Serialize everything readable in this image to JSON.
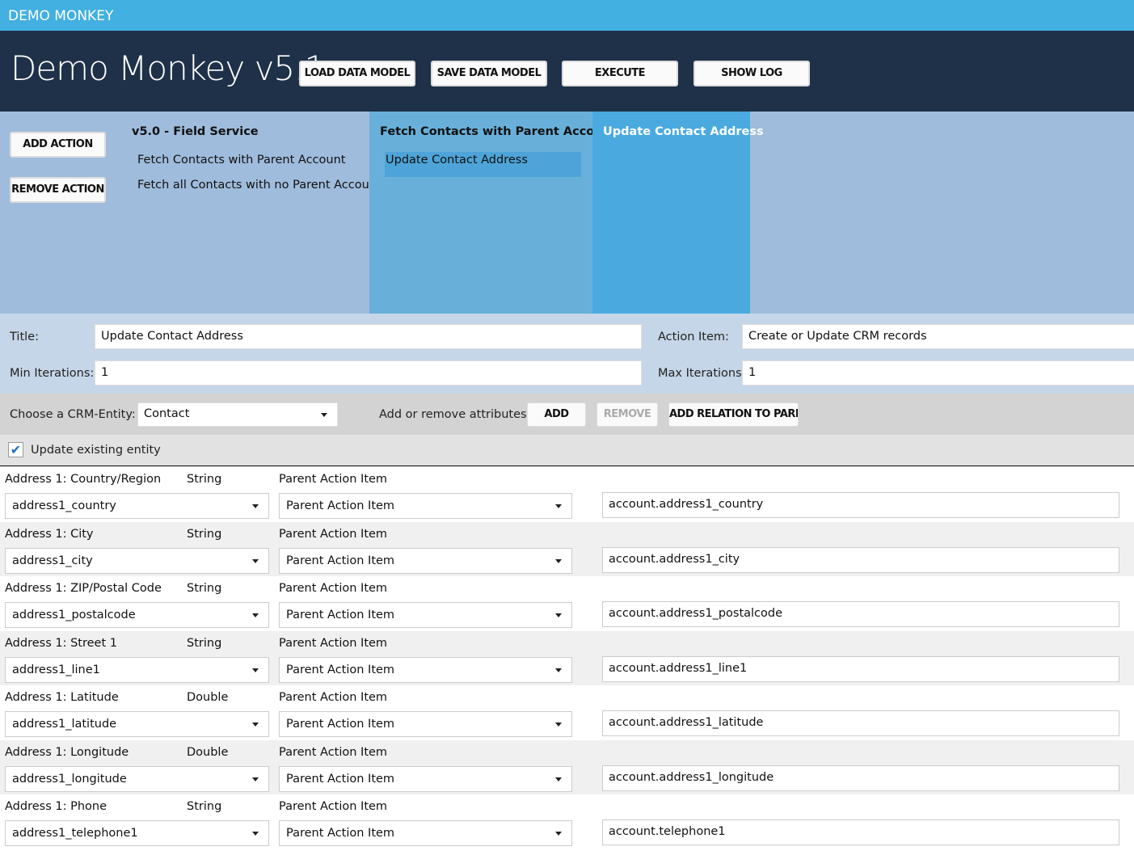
{
  "app": {
    "window_title": "DEMO MONKEY",
    "title": "Demo Monkey v5.1"
  },
  "toolbar": {
    "load": "LOAD DATA MODEL",
    "save": "SAVE DATA MODEL",
    "execute": "EXECUTE",
    "show_log": "SHOW LOG"
  },
  "actions": {
    "add": "ADD ACTION",
    "remove": "REMOVE ACTION",
    "columns": [
      {
        "title": "v5.0 - Field Service",
        "items": [
          "Fetch Contacts with Parent Account",
          "Fetch all Contacts with no Parent Account"
        ]
      },
      {
        "title": "Fetch Contacts with Parent Account",
        "items": [
          "Update Contact Address"
        ],
        "selected": "Update Contact Address"
      },
      {
        "title": "Update Contact Address",
        "items": []
      }
    ]
  },
  "form": {
    "title_label": "Title:",
    "title_value": "Update Contact Address",
    "action_item_label": "Action Item:",
    "action_item_value": "Create or Update CRM records",
    "min_label": "Min Iterations:",
    "min_value": "1",
    "max_label": "Max Iterations:",
    "max_value": "1"
  },
  "entity": {
    "label": "Choose a CRM-Entity:",
    "value": "Contact",
    "attr_label": "Add or remove attributes:",
    "add": "ADD",
    "remove": "REMOVE",
    "add_relation": "ADD RELATION TO PAREN"
  },
  "update_existing": {
    "label": "Update existing entity",
    "checked": true
  },
  "attributes": [
    {
      "name": "Address 1: Country/Region",
      "type": "String",
      "source_label": "Parent Action Item",
      "field": "address1_country",
      "source": "Parent Action Item",
      "value": "account.address1_country"
    },
    {
      "name": "Address 1: City",
      "type": "String",
      "source_label": "Parent Action Item",
      "field": "address1_city",
      "source": "Parent Action Item",
      "value": "account.address1_city"
    },
    {
      "name": "Address 1: ZIP/Postal Code",
      "type": "String",
      "source_label": "Parent Action Item",
      "field": "address1_postalcode",
      "source": "Parent Action Item",
      "value": "account.address1_postalcode"
    },
    {
      "name": "Address 1: Street 1",
      "type": "String",
      "source_label": "Parent Action Item",
      "field": "address1_line1",
      "source": "Parent Action Item",
      "value": "account.address1_line1"
    },
    {
      "name": "Address 1: Latitude",
      "type": "Double",
      "source_label": "Parent Action Item",
      "field": "address1_latitude",
      "source": "Parent Action Item",
      "value": "account.address1_latitude"
    },
    {
      "name": "Address 1: Longitude",
      "type": "Double",
      "source_label": "Parent Action Item",
      "field": "address1_longitude",
      "source": "Parent Action Item",
      "value": "account.address1_longitude"
    },
    {
      "name": "Address 1: Phone",
      "type": "String",
      "source_label": "Parent Action Item",
      "field": "address1_telephone1",
      "source": "Parent Action Item",
      "value": "account.telephone1"
    }
  ],
  "colors": {
    "topbar": "#42b0e0",
    "header": "#1e3149",
    "actions_bg": "#9fbcdc",
    "column_active": "#68b0da",
    "column_current": "#4aaae0",
    "checkbox": "#1a6fc0"
  }
}
